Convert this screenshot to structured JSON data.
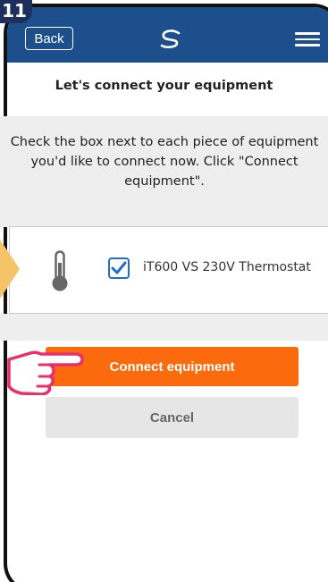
{
  "step_badge": "11",
  "header": {
    "back_label": "Back",
    "logo_icon": "salus-s-logo-icon",
    "menu_icon": "hamburger-menu-icon"
  },
  "title": "Let's connect your equipment",
  "instructions": {
    "line1": "Check the box next to each piece of equipment",
    "line2": "you'd like to connect now. Click \"Connect",
    "line3": "equipment\"."
  },
  "equipment": {
    "icon": "thermometer-icon",
    "checked": true,
    "label": "iT600 VS 230V Thermostat"
  },
  "buttons": {
    "connect_label": "Connect equipment",
    "cancel_label": "Cancel"
  },
  "colors": {
    "header": "#1c4f8c",
    "accent_orange": "#fb6a0c",
    "cancel_bg": "#e6e6e6",
    "checkbox_blue": "#1f6fc9",
    "pointer_pink": "#e8306b",
    "arrow_yellow": "#f5c469"
  }
}
